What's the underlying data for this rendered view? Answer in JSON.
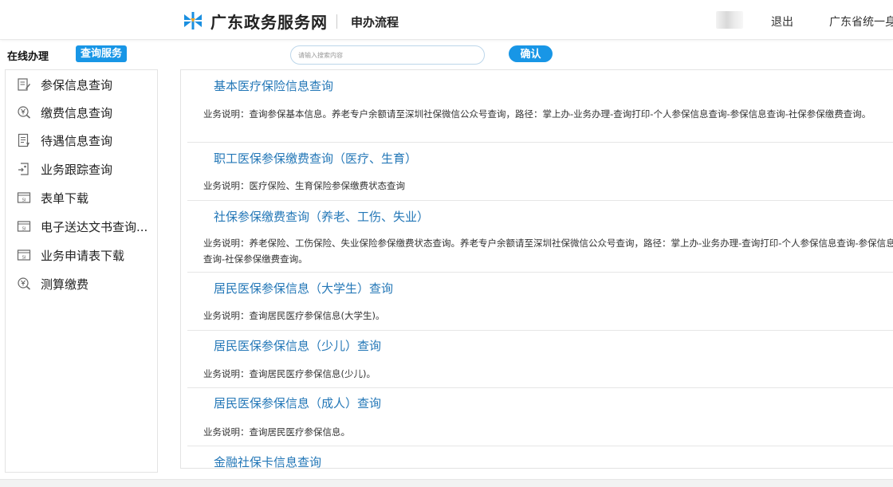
{
  "header": {
    "site_title": "广东政务服务网",
    "page_name": "申办流程",
    "logout": "退出",
    "login_label": "广东省统一身",
    "logo_colors": [
      "#1a8fe0",
      "#f5a623"
    ]
  },
  "toolbar": {
    "mode_online": "在线办理",
    "mode_query": "查询服务",
    "search_placeholder": "请输入搜索内容",
    "confirm": "确认"
  },
  "sidebar": {
    "items": [
      {
        "label": "参保信息查询",
        "icon": "edit-doc-icon"
      },
      {
        "label": "缴费信息查询",
        "icon": "yen-search-icon"
      },
      {
        "label": "待遇信息查询",
        "icon": "doc-list-icon"
      },
      {
        "label": "业务跟踪查询",
        "icon": "tracking-icon"
      },
      {
        "label": "表单下载",
        "icon": "form-icon"
      },
      {
        "label": "电子送达文书查询...",
        "icon": "form-icon"
      },
      {
        "label": "业务申请表下载",
        "icon": "form-icon"
      },
      {
        "label": "测算缴费",
        "icon": "yen-search-icon"
      }
    ]
  },
  "services": [
    {
      "title": "基本医疗保险信息查询",
      "desc": "业务说明：查询参保基本信息。养老专户余额请至深圳社保微信公众号查询，路径：掌上办-业务办理-查询打印-个人参保信息查询-参保信息查询-社保参保缴费查询。"
    },
    {
      "title": "职工医保参保缴费查询（医疗、生育）",
      "desc": "业务说明：医疗保险、生育保险参保缴费状态查询"
    },
    {
      "title": "社保参保缴费查询（养老、工伤、失业）",
      "desc": "业务说明：养老保险、工伤保险、失业保险参保缴费状态查询。养老专户余额请至深圳社保微信公众号查询，路径：掌上办-业务办理-查询打印-个人参保信息查询-参保信息查询-社保参保缴费查询。"
    },
    {
      "title": "居民医保参保信息（大学生）查询",
      "desc": "业务说明：查询居民医疗参保信息(大学生)。"
    },
    {
      "title": "居民医保参保信息（少儿）查询",
      "desc": "业务说明：查询居民医疗参保信息(少儿)。"
    },
    {
      "title": "居民医保参保信息（成人）查询",
      "desc": "业务说明：查询居民医疗参保信息。"
    },
    {
      "title": "金融社保卡信息查询",
      "desc": ""
    }
  ]
}
